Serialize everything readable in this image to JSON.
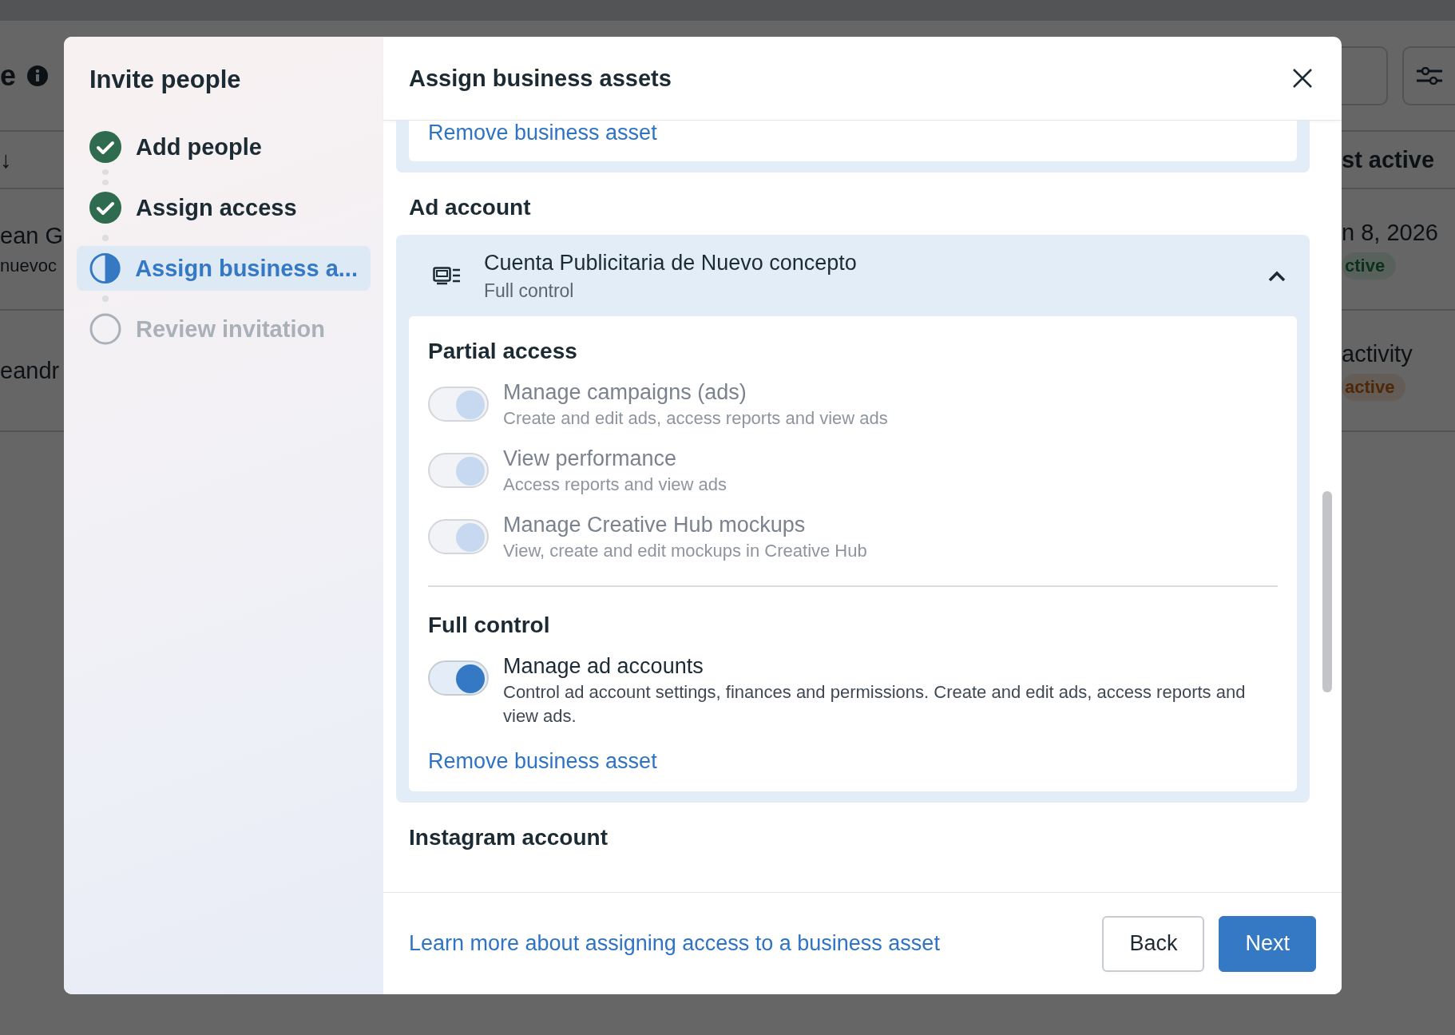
{
  "background": {
    "heading_fragment": "e",
    "sort_fragment": "↓",
    "column_fragment": "st active",
    "rows": [
      {
        "name": "ean G",
        "email": "nuevoc",
        "last_active": "n 8, 2026",
        "status": "ctive",
        "kind": "positive"
      },
      {
        "name": "eandr",
        "last_active": "activity",
        "status": "active",
        "kind": "warning"
      }
    ]
  },
  "sidebar": {
    "title": "Invite people",
    "steps": [
      {
        "label": "Add people",
        "kind": "done",
        "selected": false
      },
      {
        "label": "Assign access",
        "kind": "done",
        "selected": false
      },
      {
        "label": "Assign business a...",
        "kind": "current",
        "selected": true
      },
      {
        "label": "Review invitation",
        "kind": "upcoming",
        "selected": false
      }
    ]
  },
  "main": {
    "title": "Assign business assets",
    "previous_card": {
      "remove_link": "Remove business asset"
    },
    "sections": [
      {
        "heading": "Ad account",
        "asset": {
          "name": "Cuenta Publicitaria de Nuevo concepto",
          "role": "Full control",
          "expanded": true,
          "groups": [
            {
              "heading": "Partial access",
              "permissions": [
                {
                  "label": "Manage campaigns (ads)",
                  "description": "Create and edit ads, access reports and view ads",
                  "on": true,
                  "disabled": true
                },
                {
                  "label": "View performance",
                  "description": "Access reports and view ads",
                  "on": true,
                  "disabled": true
                },
                {
                  "label": "Manage Creative Hub mockups",
                  "description": "View, create and edit mockups in Creative Hub",
                  "on": true,
                  "disabled": true
                }
              ]
            },
            {
              "heading": "Full control",
              "permissions": [
                {
                  "label": "Manage ad accounts",
                  "description": "Control ad account settings, finances and permissions. Create and edit ads, access reports and view ads.",
                  "on": true,
                  "disabled": false
                }
              ]
            }
          ],
          "remove_link": "Remove business asset"
        }
      },
      {
        "heading": "Instagram account"
      }
    ]
  },
  "footer": {
    "learn_more_link": "Learn more about assigning access to a business asset",
    "buttons": [
      {
        "label": "Back",
        "kind": "secondary"
      },
      {
        "label": "Next",
        "kind": "primary"
      }
    ]
  }
}
